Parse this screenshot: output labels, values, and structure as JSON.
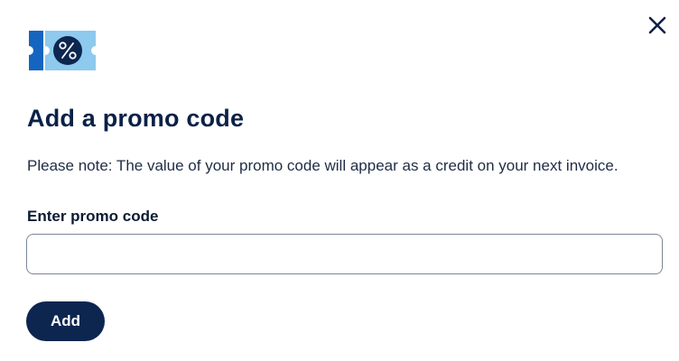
{
  "dialog": {
    "title": "Add a promo code",
    "note": "Please note: The value of your promo code will appear as a credit on your next invoice.",
    "field_label": "Enter promo code",
    "input_value": "",
    "input_placeholder": "",
    "add_label": "Add"
  },
  "icons": {
    "close": "close-icon",
    "promo": "promo-ticket-icon",
    "percent": "percent-icon"
  },
  "colors": {
    "primary": "#0c2650",
    "ticket_dark": "#1565c0",
    "ticket_light": "#8ec9ee",
    "text": "#0b2147"
  }
}
